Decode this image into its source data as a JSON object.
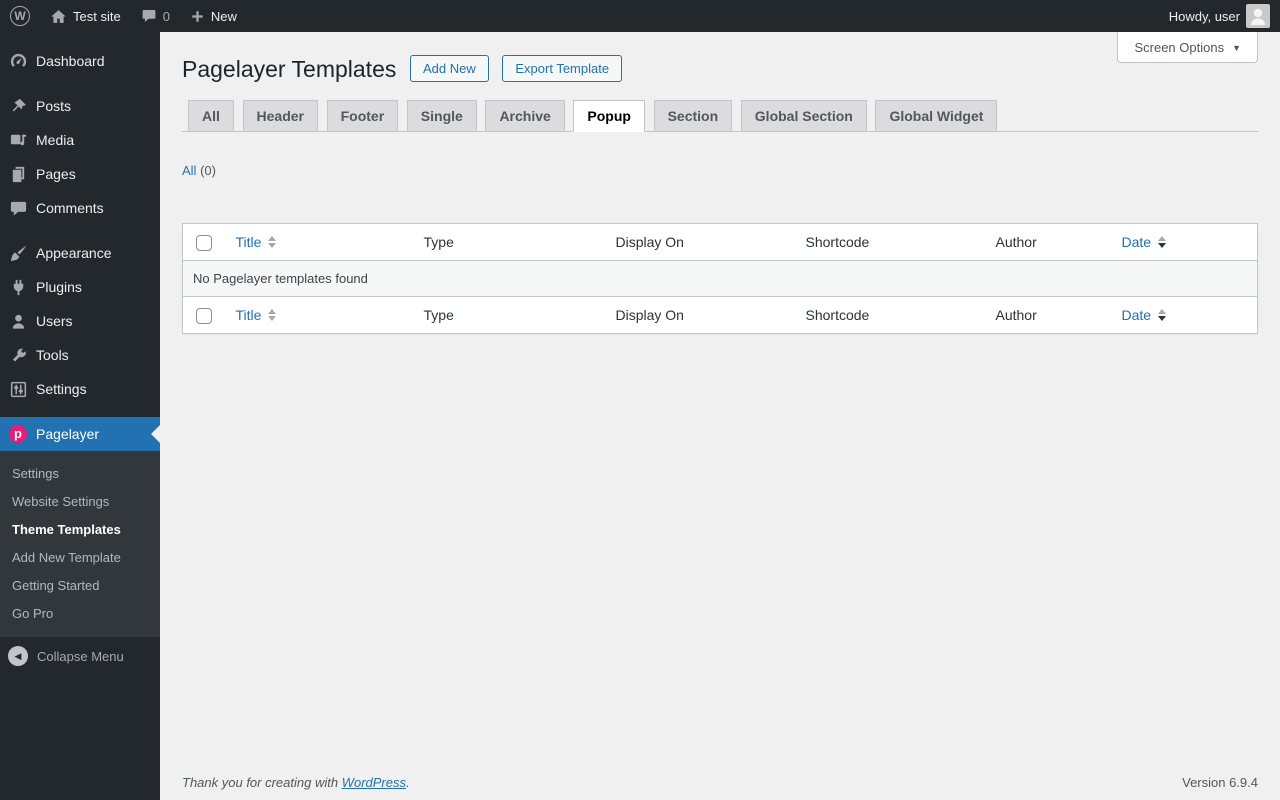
{
  "admin_bar": {
    "site_name": "Test site",
    "comments_count": "0",
    "new_label": "New",
    "howdy": "Howdy, user"
  },
  "sidebar": {
    "items": [
      {
        "label": "Dashboard"
      },
      {
        "label": "Posts"
      },
      {
        "label": "Media"
      },
      {
        "label": "Pages"
      },
      {
        "label": "Comments"
      },
      {
        "label": "Appearance"
      },
      {
        "label": "Plugins"
      },
      {
        "label": "Users"
      },
      {
        "label": "Tools"
      },
      {
        "label": "Settings"
      }
    ],
    "pagelayer": {
      "label": "Pagelayer",
      "submenu": [
        {
          "label": "Settings"
        },
        {
          "label": "Website Settings"
        },
        {
          "label": "Theme Templates",
          "current": true
        },
        {
          "label": "Add New Template"
        },
        {
          "label": "Getting Started"
        },
        {
          "label": "Go Pro"
        }
      ]
    },
    "collapse_label": "Collapse Menu"
  },
  "page": {
    "title": "Pagelayer Templates",
    "actions": {
      "add_new": "Add New",
      "export_template": "Export Template"
    },
    "screen_options_label": "Screen Options",
    "tabs": [
      {
        "label": "All"
      },
      {
        "label": "Header"
      },
      {
        "label": "Footer"
      },
      {
        "label": "Single"
      },
      {
        "label": "Archive"
      },
      {
        "label": "Popup",
        "active": true
      },
      {
        "label": "Section"
      },
      {
        "label": "Global Section"
      },
      {
        "label": "Global Widget"
      }
    ],
    "filter": {
      "all_label": "All",
      "count": "(0)"
    }
  },
  "table": {
    "headers": {
      "title": "Title",
      "type": "Type",
      "display_on": "Display On",
      "shortcode": "Shortcode",
      "author": "Author",
      "date": "Date"
    },
    "empty_message": "No Pagelayer templates found"
  },
  "footer": {
    "thanks_prefix": "Thank you for creating with ",
    "wordpress_link": "WordPress",
    "thanks_suffix": ".",
    "version": "Version 6.9.4"
  },
  "colors": {
    "accent": "#2271b1",
    "pagelayer_pink": "#e81c7a",
    "menu_bg": "#23282d",
    "submenu_bg": "#32373c",
    "content_bg": "#f0f0f1",
    "border": "#c3c4c7"
  }
}
